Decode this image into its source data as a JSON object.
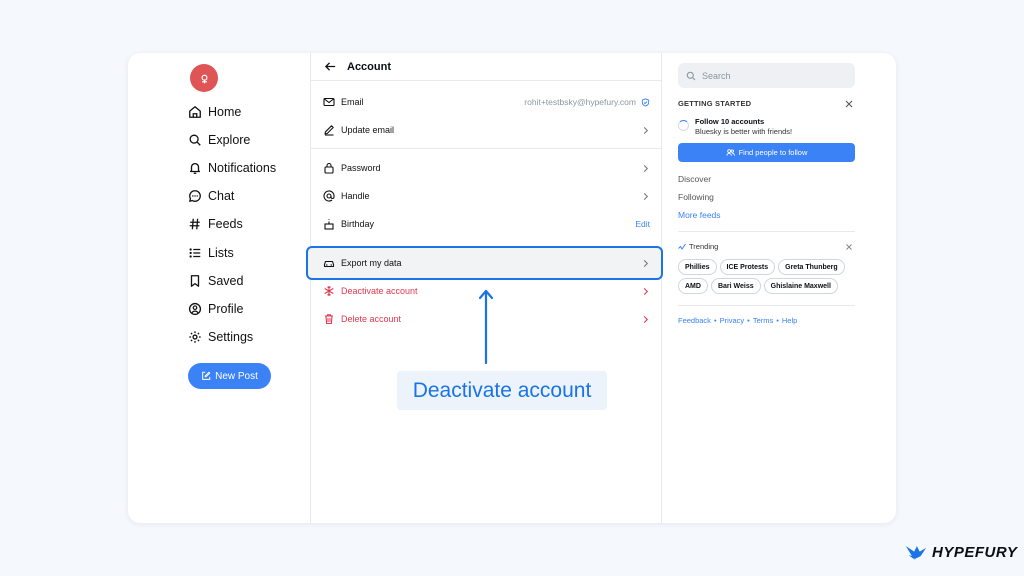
{
  "nav": {
    "items": [
      {
        "label": "Home",
        "icon": "home-icon"
      },
      {
        "label": "Explore",
        "icon": "search-icon"
      },
      {
        "label": "Notifications",
        "icon": "bell-icon"
      },
      {
        "label": "Chat",
        "icon": "chat-icon"
      },
      {
        "label": "Feeds",
        "icon": "hash-icon"
      },
      {
        "label": "Lists",
        "icon": "list-icon"
      },
      {
        "label": "Saved",
        "icon": "bookmark-icon"
      },
      {
        "label": "Profile",
        "icon": "profile-icon"
      },
      {
        "label": "Settings",
        "icon": "gear-icon"
      }
    ],
    "new_post": "New Post"
  },
  "account": {
    "title": "Account",
    "email_label": "Email",
    "email_value": "rohit+testbsky@hypefury.com",
    "update_email": "Update email",
    "password": "Password",
    "handle": "Handle",
    "birthday": "Birthday",
    "birthday_edit": "Edit",
    "export": "Export my data",
    "deactivate": "Deactivate account",
    "delete": "Delete account"
  },
  "callout": "Deactivate account",
  "sidebar": {
    "search_placeholder": "Search",
    "getting_started": "GETTING STARTED",
    "task_title": "Follow 10 accounts",
    "task_sub": "Bluesky is better with friends!",
    "find_button": "Find people to follow",
    "feeds": [
      "Discover",
      "Following",
      "More feeds"
    ],
    "trending_label": "Trending",
    "trending": [
      "Phillies",
      "ICE Protests",
      "Greta Thunberg",
      "AMD",
      "Bari Weiss",
      "Ghislaine Maxwell"
    ],
    "footer": [
      "Feedback",
      "Privacy",
      "Terms",
      "Help"
    ],
    "footer_sep": "•"
  },
  "brand": "HYPEFURY",
  "colors": {
    "accent": "#3b82f6",
    "danger": "#e0394f",
    "highlight": "#1a73e8"
  }
}
